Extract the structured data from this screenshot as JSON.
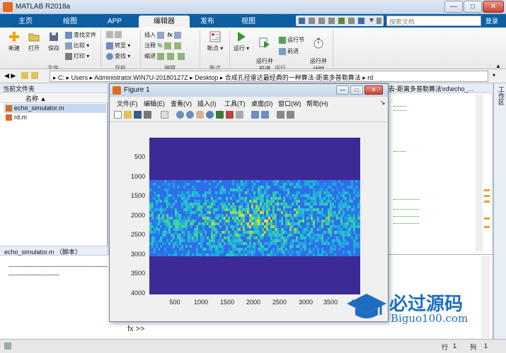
{
  "window": {
    "title": "MATLAB R2018a",
    "min": "—",
    "max": "□",
    "close": "✕"
  },
  "tabs": [
    {
      "label": "主页"
    },
    {
      "label": "绘图"
    },
    {
      "label": "APP"
    },
    {
      "label": "编辑器",
      "active": true
    },
    {
      "label": "发布"
    },
    {
      "label": "视图"
    }
  ],
  "search": {
    "placeholder": "搜索文档",
    "login": "登录"
  },
  "ribbon": {
    "file": {
      "new": "新建",
      "open": "打开",
      "save": "保存",
      "find_file": "查找文件",
      "compare": "比较",
      "print": "打印",
      "group": "文件"
    },
    "nav": {
      "goto": "转至",
      "find": "查找",
      "group": "导航"
    },
    "edit": {
      "insert": "插入",
      "comment": "注释",
      "indent": "缩进",
      "group": "编辑"
    },
    "breakpoint": {
      "label": "断点",
      "group": "断点"
    },
    "run": {
      "run": "运行",
      "run_advance": "运行并\n前进",
      "run_section": "运行节",
      "advance": "前进",
      "run_time": "运行并\n计时",
      "group": "运行"
    }
  },
  "address": {
    "path": [
      "C:",
      "Users",
      "Administrator.WIN7U-20180127Z",
      "Desktop",
      "合成孔径雷达最经典的一种算法-距离多普勒算法",
      "rd"
    ]
  },
  "left_pane": {
    "title": "当前文件夹",
    "col_name": "名称 ▲",
    "files": [
      {
        "name": "echo_simulator.m",
        "selected": true
      },
      {
        "name": "rd.m",
        "selected": false
      }
    ],
    "detail_title": "echo_simulator.m （脚本）",
    "detail_line1": "------------------------------------------------",
    "detail_line2": "------------------------"
  },
  "editor": {
    "tab": "去-距离多普勒算法\\rd\\echo_..."
  },
  "vtab": "工作区",
  "figure": {
    "title": "Figure 1",
    "menu": [
      "文件(F)",
      "编辑(E)",
      "查看(V)",
      "插入(I)",
      "工具(T)",
      "桌面(D)",
      "窗口(W)",
      "帮助(H)"
    ],
    "yticks": [
      "500",
      "1000",
      "1500",
      "2000",
      "2500",
      "3000",
      "3500",
      "4000"
    ],
    "xticks": [
      "500",
      "1000",
      "1500",
      "2000",
      "2500",
      "3000",
      "3500",
      "40"
    ]
  },
  "command": {
    "prompt": "fx >>"
  },
  "status": {
    "row_label": "行",
    "row": "1",
    "col_label": "列",
    "col": "1"
  },
  "watermark": {
    "brand": "必过源码",
    "url": "Biguo100.com"
  },
  "colors": {
    "ribbon_blue": "#0e5ea3",
    "plot_bg": "#3e2a97",
    "plot_band": "#2d7ff0",
    "accent": "#1f6dc2"
  }
}
